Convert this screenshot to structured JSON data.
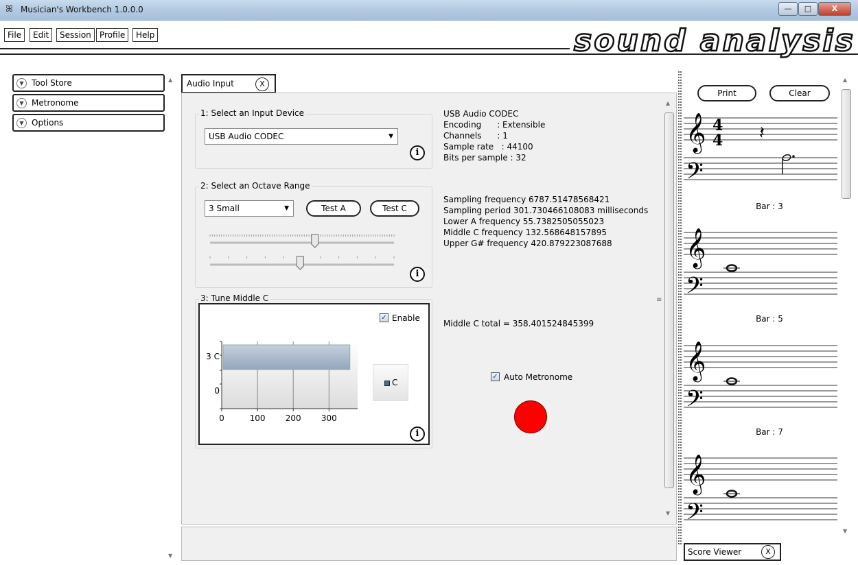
{
  "window": {
    "title": "Musician's Workbench 1.0.0.0",
    "app_icon": "butterfly-icon",
    "minimize": "—",
    "maximize": "□",
    "close": "X"
  },
  "menu": {
    "items": [
      "File",
      "Edit",
      "Session",
      "Profile",
      "Help"
    ]
  },
  "logo": {
    "text": "sound analysis"
  },
  "sidebar": {
    "items": [
      {
        "label": "Tool Store",
        "icon": "chevron-down-icon"
      },
      {
        "label": "Metronome",
        "icon": "chevron-down-icon"
      },
      {
        "label": "Options",
        "icon": "chevron-down-icon"
      }
    ]
  },
  "audio_input": {
    "tab_label": "Audio Input",
    "close_label": "X",
    "input_device": {
      "title": "1: Select an Input Device",
      "selected": "USB Audio CODEC",
      "info": "USB Audio CODEC\nEncoding      : Extensible\nChannels      : 1\nSample rate   : 44100\nBits per sample : 32"
    },
    "octave_range": {
      "title": "2: Select an Octave Range",
      "selected": "3  Small",
      "test_a": "Test A",
      "test_c": "Test C",
      "slider1_value": 0.57,
      "slider2_value": 0.49,
      "info": "Sampling frequency 6787.51478568421\nSampling period 301.730466108083 milliseconds\nLower A frequency 55.7382505055023\nMiddle C frequency 132.568648157895\nUpper G# frequency 420.879223087688"
    },
    "tune_middle_c": {
      "title": "3: Tune Middle C",
      "enable_label": "Enable",
      "enable_checked": true,
      "total_text": "Middle C total = 358.401524845399",
      "auto_metronome_label": "Auto Metronome",
      "auto_metronome_checked": true,
      "indicator_color": "#ff0000"
    },
    "info_glyph": "i"
  },
  "chart_data": {
    "type": "bar",
    "orientation": "horizontal",
    "categories": [
      "3 C"
    ],
    "y_ticks": [
      "3 C",
      "0"
    ],
    "x_ticks": [
      "0",
      "100",
      "200",
      "300"
    ],
    "xlim": [
      0,
      380
    ],
    "series": [
      {
        "name": "C",
        "values": [
          358.4
        ]
      }
    ],
    "legend": "right",
    "bar_color": "#a8b8cc"
  },
  "score_viewer": {
    "print_label": "Print",
    "clear_label": "Clear",
    "time_signature": [
      "4",
      "4"
    ],
    "bars": [
      "Bar : 3",
      "Bar : 5",
      "Bar : 7"
    ],
    "tab_label": "Score Viewer",
    "close_label": "X"
  }
}
